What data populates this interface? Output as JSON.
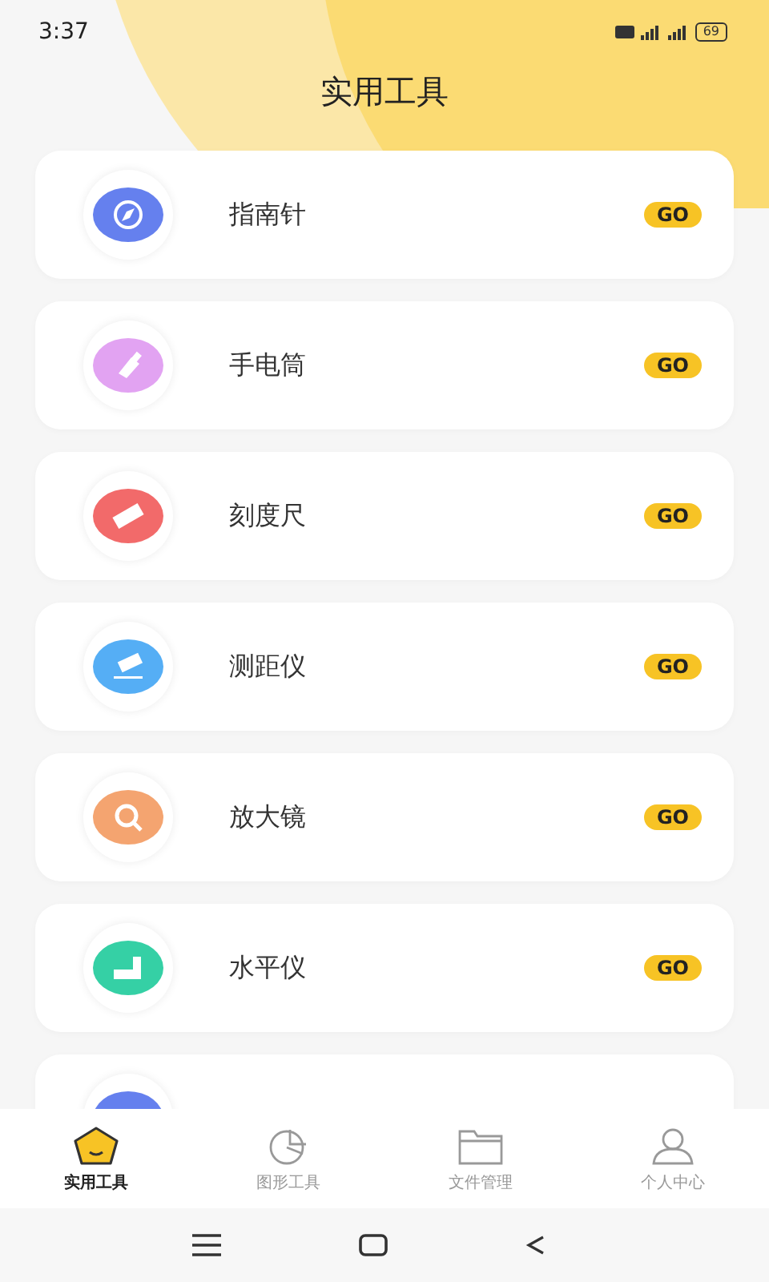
{
  "status_bar": {
    "time": "3:37",
    "battery": "69"
  },
  "title": "实用工具",
  "tools": [
    {
      "kind": "compass",
      "label": "指南针",
      "color": "#6580ee",
      "action": "GO"
    },
    {
      "kind": "flashlight",
      "label": "手电筒",
      "color": "#e2a3f2",
      "action": "GO"
    },
    {
      "kind": "ruler",
      "label": "刻度尺",
      "color": "#f26a6a",
      "action": "GO"
    },
    {
      "kind": "rangefinder",
      "label": "测距仪",
      "color": "#55aef5",
      "action": "GO"
    },
    {
      "kind": "magnifier",
      "label": "放大镜",
      "color": "#f4a470",
      "action": "GO"
    },
    {
      "kind": "level",
      "label": "水平仪",
      "color": "#35d0a5",
      "action": "GO"
    },
    {
      "kind": "other",
      "color": "#6580ee"
    }
  ],
  "tabs": [
    {
      "kind": "tools",
      "label": "实用工具",
      "selected": true
    },
    {
      "kind": "chart",
      "label": "图形工具",
      "selected": false
    },
    {
      "kind": "folder",
      "label": "文件管理",
      "selected": false
    },
    {
      "kind": "person",
      "label": "个人中心",
      "selected": false
    }
  ]
}
